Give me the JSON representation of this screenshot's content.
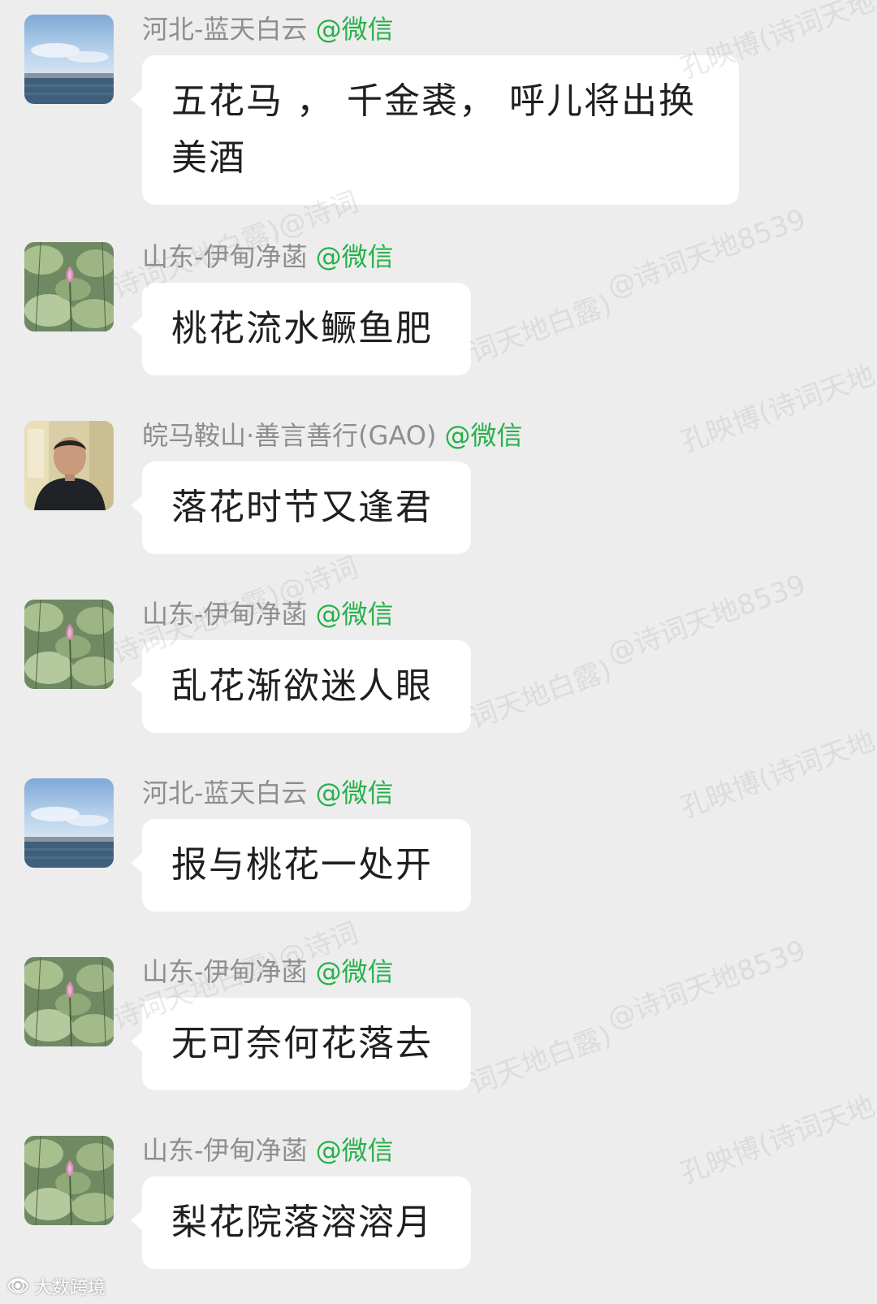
{
  "messages": [
    {
      "sender": "河北-蓝天白云",
      "source_tag": "@微信",
      "text": "五花马 ， 千金裘， 呼儿将出换美酒",
      "avatar": "sea-sky-avatar"
    },
    {
      "sender": "山东-伊甸净菡",
      "source_tag": "@微信",
      "text": "桃花流水鳜鱼肥",
      "avatar": "lotus-avatar"
    },
    {
      "sender": "皖马鞍山·善言善行(GAO)",
      "source_tag": "@微信",
      "text": "落花时节又逢君",
      "avatar": "person-avatar"
    },
    {
      "sender": "山东-伊甸净菡",
      "source_tag": "@微信",
      "text": "乱花渐欲迷人眼",
      "avatar": "lotus-avatar"
    },
    {
      "sender": "河北-蓝天白云",
      "source_tag": "@微信",
      "text": "报与桃花一处开",
      "avatar": "sea-sky-avatar"
    },
    {
      "sender": "山东-伊甸净菡",
      "source_tag": "@微信",
      "text": "无可奈何花落去",
      "avatar": "lotus-avatar"
    },
    {
      "sender": "山东-伊甸净菡",
      "source_tag": "@微信",
      "text": "梨花院落溶溶月",
      "avatar": "lotus-avatar"
    }
  ],
  "watermarks": {
    "a": "孔映博(诗词天地",
    "b": "@诗词天地8539",
    "c": "诗词天地白露)@诗词",
    "d": "词天地白露)"
  },
  "footer": {
    "logo_text": "大数跨境"
  },
  "colors": {
    "background": "#ededed",
    "bubble": "#ffffff",
    "sender_name": "#8e8e8e",
    "wechat_tag": "#28b04a"
  }
}
